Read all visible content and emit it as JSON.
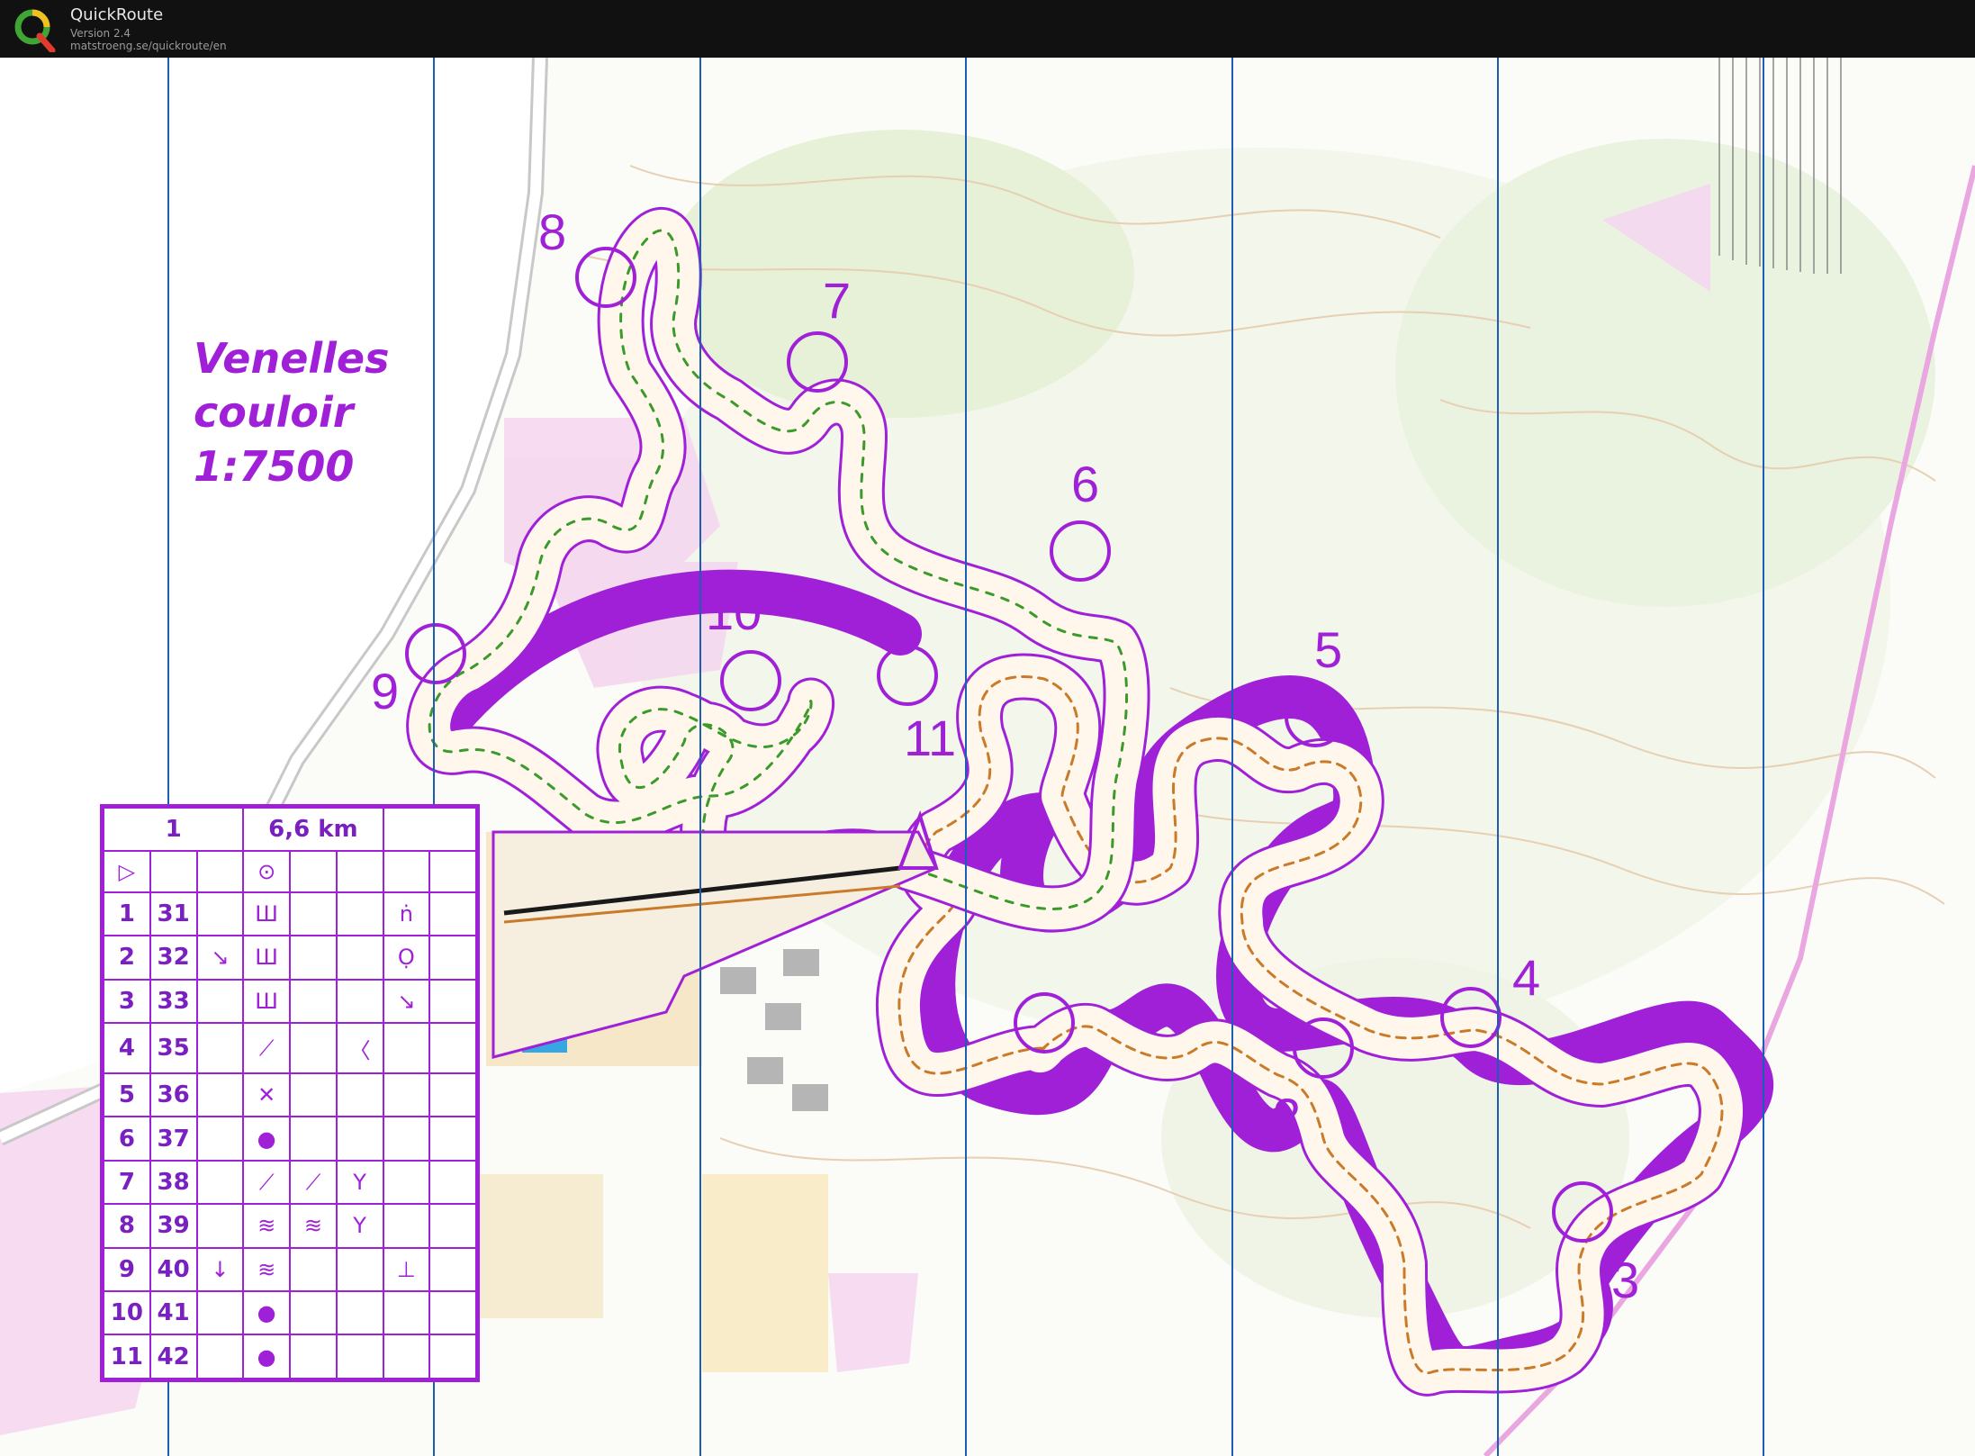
{
  "app": {
    "title": "QuickRoute",
    "version": "Version 2.4",
    "url": "matstroeng.se/quickroute/en"
  },
  "map": {
    "title_lines": [
      "Venelles",
      "couloir",
      "1:7500"
    ],
    "controls": [
      "1",
      "2",
      "3",
      "4",
      "5",
      "6",
      "7",
      "8",
      "9",
      "10",
      "11"
    ],
    "course_color": "#a020d8",
    "grid_line_color": "#1a5fb4"
  },
  "description_sheet": {
    "header": {
      "course": "1",
      "length": "6,6 km"
    },
    "start_symbols": [
      "start-triangle",
      "start-circle"
    ],
    "rows": [
      {
        "num": "1",
        "code": "31",
        "c": "",
        "d": "Ш",
        "e": "",
        "f": "",
        "g": "ṅ"
      },
      {
        "num": "2",
        "code": "32",
        "c": "↘",
        "d": "Ш",
        "e": "",
        "f": "",
        "g": "Ọ"
      },
      {
        "num": "3",
        "code": "33",
        "c": "",
        "d": "Ш",
        "e": "",
        "f": "",
        "g": "↘"
      },
      {
        "num": "4",
        "code": "35",
        "c": "",
        "d": "⟋",
        "e": "",
        "f": "〈",
        "g": ""
      },
      {
        "num": "5",
        "code": "36",
        "c": "",
        "d": "✕",
        "e": "",
        "f": "",
        "g": ""
      },
      {
        "num": "6",
        "code": "37",
        "c": "",
        "d": "●",
        "e": "",
        "f": "",
        "g": ""
      },
      {
        "num": "7",
        "code": "38",
        "c": "",
        "d": "⟋",
        "e": "⟋",
        "f": "Y",
        "g": ""
      },
      {
        "num": "8",
        "code": "39",
        "c": "",
        "d": "≋",
        "e": "≋",
        "f": "Y",
        "g": ""
      },
      {
        "num": "9",
        "code": "40",
        "c": "↓",
        "d": "≋",
        "e": "",
        "f": "",
        "g": "⊥"
      },
      {
        "num": "10",
        "code": "41",
        "c": "",
        "d": "●",
        "e": "",
        "f": "",
        "g": ""
      },
      {
        "num": "11",
        "code": "42",
        "c": "",
        "d": "●",
        "e": "",
        "f": "",
        "g": ""
      }
    ]
  }
}
